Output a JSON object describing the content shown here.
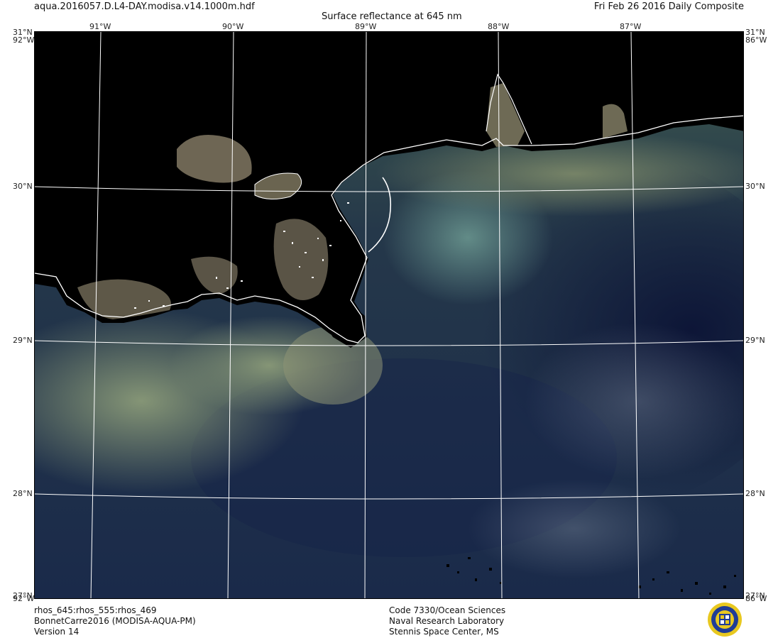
{
  "header": {
    "filename": "aqua.2016057.D.L4-DAY.modisa.v14.1000m.hdf",
    "title": "Surface reflectance at 645 nm",
    "date_label": "Fri Feb 26 2016 Daily Composite"
  },
  "axes": {
    "lon_top": [
      "91°W",
      "90°W",
      "89°W",
      "88°W",
      "87°W"
    ],
    "lat_left": [
      "30°N",
      "29°N",
      "28°N"
    ],
    "lat_right": [
      "30°N",
      "29°N",
      "28°N"
    ],
    "corner_top_left": "31°N",
    "corner_top_left_lon": "92°W",
    "corner_top_right": "31°N",
    "corner_top_right_lon": "86°W",
    "corner_bottom_left": "27°N",
    "corner_bottom_left_lon": "92°W",
    "corner_bottom_right": "27°N",
    "corner_bottom_right_lon": "86°W"
  },
  "footer": {
    "bands": "rhos_645:rhos_555:rhos_469",
    "project": "BonnetCarre2016 (MODISA-AQUA-PM)",
    "version": "Version 14",
    "org_code": "Code 7330/Ocean Sciences",
    "org_name": "Naval Research Laboratory",
    "org_location": "Stennis Space Center, MS"
  },
  "colors": {
    "land": "#000000",
    "deep_water": "#101a3c",
    "shelf_water": "#2a3e42",
    "turbid_plume": "#7d8e6e",
    "marsh": "#6e6555",
    "grid": "#ffffff",
    "coastline": "#ffffff",
    "seal_blue": "#1f3c96",
    "seal_gold": "#e8c820"
  },
  "icons": [
    "nrl-seal-icon"
  ]
}
